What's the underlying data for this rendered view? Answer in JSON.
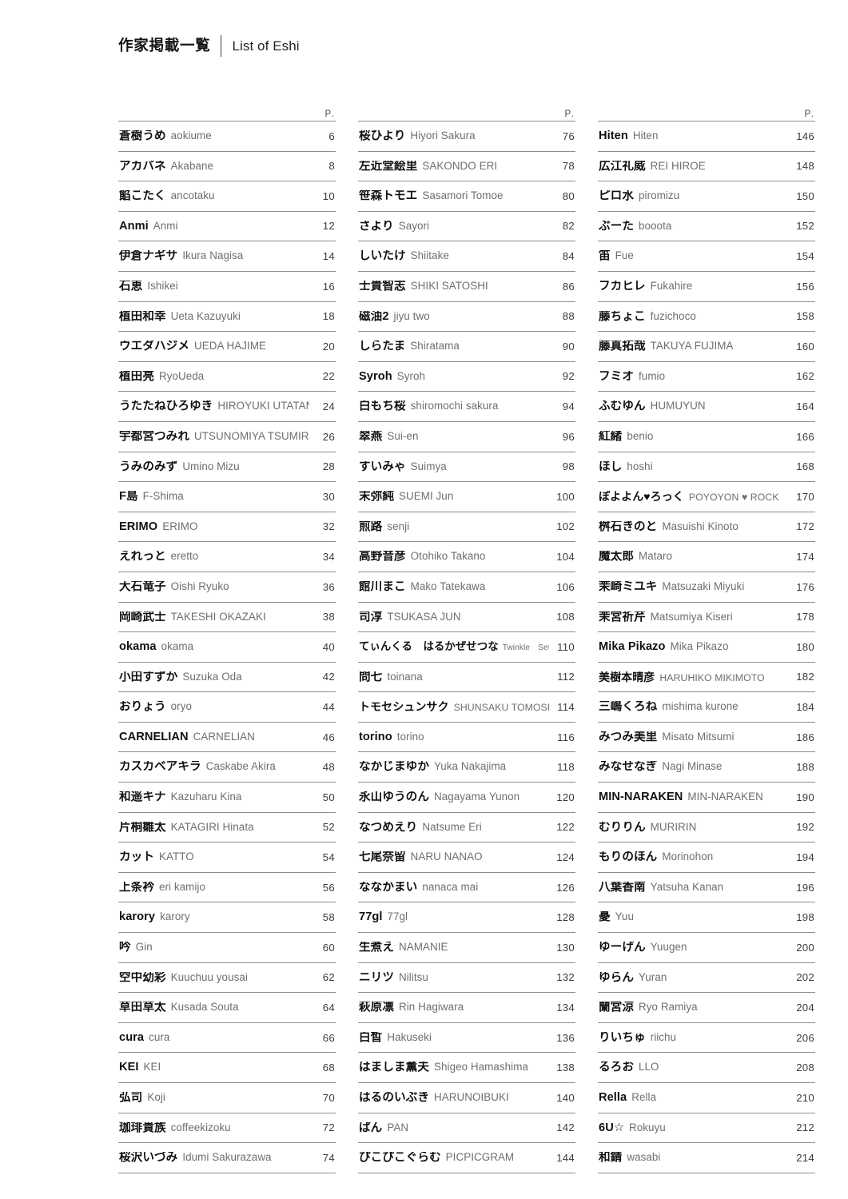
{
  "header": {
    "title_ja": "作家掲載一覧",
    "title_en": "List of Eshi"
  },
  "page_column_label": "P.",
  "colors": {
    "text": "#111111",
    "subtext": "#6e6e6e",
    "rule": "#8d8d8d",
    "page_number": "#3c3c3c",
    "background": "#ffffff"
  },
  "columns": [
    {
      "id": "column-1",
      "p_label": "P.",
      "entries": [
        {
          "name_ja": "蒼樹うめ",
          "name_en": "aokiume",
          "page": "6"
        },
        {
          "name_ja": "アカバネ",
          "name_en": "Akabane",
          "page": "8"
        },
        {
          "name_ja": "餡こたく",
          "name_en": "ancotaku",
          "page": "10"
        },
        {
          "name_ja": "Anmi",
          "name_en": "Anmi",
          "page": "12"
        },
        {
          "name_ja": "伊倉ナギサ",
          "name_en": "Ikura Nagisa",
          "page": "14"
        },
        {
          "name_ja": "石恵",
          "name_en": "Ishikei",
          "page": "16"
        },
        {
          "name_ja": "植田和幸",
          "name_en": "Ueta Kazuyuki",
          "page": "18"
        },
        {
          "name_ja": "ウエダハジメ",
          "name_en": "UEDA HAJIME",
          "page": "20"
        },
        {
          "name_ja": "植田亮",
          "name_en": "RyoUeda",
          "page": "22"
        },
        {
          "name_ja": "うたたねひろゆき",
          "name_en": "HIROYUKI UTATANE",
          "page": "24"
        },
        {
          "name_ja": "宇都宮つみれ",
          "name_en": "UTSUNOMIYA TSUMIRE",
          "page": "26"
        },
        {
          "name_ja": "うみのみず",
          "name_en": "Umino Mizu",
          "page": "28"
        },
        {
          "name_ja": "F島",
          "name_en": "F-Shima",
          "page": "30"
        },
        {
          "name_ja": "ERIMO",
          "name_en": "ERIMO",
          "page": "32"
        },
        {
          "name_ja": "えれっと",
          "name_en": "eretto",
          "page": "34"
        },
        {
          "name_ja": "大石竜子",
          "name_en": "Oishi Ryuko",
          "page": "36"
        },
        {
          "name_ja": "岡崎武士",
          "name_en": "TAKESHI OKAZAKI",
          "page": "38"
        },
        {
          "name_ja": "okama",
          "name_en": "okama",
          "page": "40"
        },
        {
          "name_ja": "小田すずか",
          "name_en": "Suzuka Oda",
          "page": "42"
        },
        {
          "name_ja": "おりょう",
          "name_en": "oryo",
          "page": "44"
        },
        {
          "name_ja": "CARNELIAN",
          "name_en": "CARNELIAN",
          "page": "46"
        },
        {
          "name_ja": "カスカベアキラ",
          "name_en": "Caskabe Akira",
          "page": "48"
        },
        {
          "name_ja": "和遥キナ",
          "name_en": "Kazuharu Kina",
          "page": "50"
        },
        {
          "name_ja": "片桐雛太",
          "name_en": "KATAGIRI Hinata",
          "page": "52"
        },
        {
          "name_ja": "カット",
          "name_en": "KATTO",
          "page": "54"
        },
        {
          "name_ja": "上条衿",
          "name_en": "eri kamijo",
          "page": "56"
        },
        {
          "name_ja": "karory",
          "name_en": "karory",
          "page": "58"
        },
        {
          "name_ja": "吟",
          "name_en": "Gin",
          "page": "60"
        },
        {
          "name_ja": "空中幼彩",
          "name_en": "Kuuchuu yousai",
          "page": "62"
        },
        {
          "name_ja": "草田草太",
          "name_en": "Kusada Souta",
          "page": "64"
        },
        {
          "name_ja": "cura",
          "name_en": "cura",
          "page": "66"
        },
        {
          "name_ja": "KEI",
          "name_en": "KEI",
          "page": "68"
        },
        {
          "name_ja": "弘司",
          "name_en": "Koji",
          "page": "70"
        },
        {
          "name_ja": "珈琲貴族",
          "name_en": "coffeekizoku",
          "page": "72"
        },
        {
          "name_ja": "桜沢いづみ",
          "name_en": "Idumi Sakurazawa",
          "page": "74"
        }
      ]
    },
    {
      "id": "column-2",
      "p_label": "P.",
      "entries": [
        {
          "name_ja": "桜ひより",
          "name_en": "Hiyori Sakura",
          "page": "76"
        },
        {
          "name_ja": "左近堂絵里",
          "name_en": "SAKONDO ERI",
          "page": "78"
        },
        {
          "name_ja": "笹森トモエ",
          "name_en": "Sasamori Tomoe",
          "page": "80"
        },
        {
          "name_ja": "さより",
          "name_en": "Sayori",
          "page": "82"
        },
        {
          "name_ja": "しいたけ",
          "name_en": "Shiitake",
          "page": "84"
        },
        {
          "name_ja": "士貴智志",
          "name_en": "SHIKI SATOSHI",
          "page": "86"
        },
        {
          "name_ja": "磁油2",
          "name_en": "jiyu two",
          "page": "88"
        },
        {
          "name_ja": "しらたま",
          "name_en": "Shiratama",
          "page": "90"
        },
        {
          "name_ja": "Syroh",
          "name_en": "Syroh",
          "page": "92"
        },
        {
          "name_ja": "白もち桜",
          "name_en": "shiromochi sakura",
          "page": "94"
        },
        {
          "name_ja": "翠燕",
          "name_en": "Sui-en",
          "page": "96"
        },
        {
          "name_ja": "すいみゃ",
          "name_en": "Suimya",
          "page": "98"
        },
        {
          "name_ja": "末弥純",
          "name_en": "SUEMI Jun",
          "page": "100"
        },
        {
          "name_ja": "煎路",
          "name_en": "senji",
          "page": "102"
        },
        {
          "name_ja": "高野音彦",
          "name_en": "Otohiko Takano",
          "page": "104"
        },
        {
          "name_ja": "館川まこ",
          "name_en": "Mako Tatekawa",
          "page": "106"
        },
        {
          "name_ja": "司淳",
          "name_en": "TSUKASA JUN",
          "page": "108"
        },
        {
          "name_ja": "てぃんくる　はるかぜせつな",
          "name_en": "Twinkle　Setsuna Harukaze",
          "page": "110",
          "size": "tighter"
        },
        {
          "name_ja": "問七",
          "name_en": "toinana",
          "page": "112"
        },
        {
          "name_ja": "トモセシュンサク",
          "name_en": "SHUNSAKU TOMOSE",
          "page": "114",
          "size": "tight"
        },
        {
          "name_ja": "torino",
          "name_en": "torino",
          "page": "116"
        },
        {
          "name_ja": "なかじまゆか",
          "name_en": "Yuka Nakajima",
          "page": "118"
        },
        {
          "name_ja": "永山ゆうのん",
          "name_en": "Nagayama Yunon",
          "page": "120"
        },
        {
          "name_ja": "なつめえり",
          "name_en": "Natsume Eri",
          "page": "122"
        },
        {
          "name_ja": "七尾奈留",
          "name_en": "NARU NANAO",
          "page": "124"
        },
        {
          "name_ja": "ななかまい",
          "name_en": "nanaca mai",
          "page": "126"
        },
        {
          "name_ja": "77gl",
          "name_en": "77gl",
          "page": "128"
        },
        {
          "name_ja": "生煮え",
          "name_en": "NAMANIE",
          "page": "130"
        },
        {
          "name_ja": "ニリツ",
          "name_en": "Nilitsu",
          "page": "132"
        },
        {
          "name_ja": "萩原凛",
          "name_en": "Rin Hagiwara",
          "page": "134"
        },
        {
          "name_ja": "白皙",
          "name_en": "Hakuseki",
          "page": "136"
        },
        {
          "name_ja": "はましま薫夫",
          "name_en": "Shigeo Hamashima",
          "page": "138"
        },
        {
          "name_ja": "はるのいぶき",
          "name_en": "HARUNOIBUKI",
          "page": "140"
        },
        {
          "name_ja": "ぱん",
          "name_en": "PAN",
          "page": "142"
        },
        {
          "name_ja": "ぴこぴこぐらむ",
          "name_en": "PICPICGRAM",
          "page": "144"
        }
      ]
    },
    {
      "id": "column-3",
      "p_label": "P.",
      "entries": [
        {
          "name_ja": "Hiten",
          "name_en": "Hiten",
          "page": "146"
        },
        {
          "name_ja": "広江礼威",
          "name_en": "REI HIROE",
          "page": "148"
        },
        {
          "name_ja": "ピロ水",
          "name_en": "piromizu",
          "page": "150"
        },
        {
          "name_ja": "ぶーた",
          "name_en": "booota",
          "page": "152"
        },
        {
          "name_ja": "笛",
          "name_en": "Fue",
          "page": "154"
        },
        {
          "name_ja": "フカヒレ",
          "name_en": "Fukahire",
          "page": "156"
        },
        {
          "name_ja": "藤ちょこ",
          "name_en": "fuzichoco",
          "page": "158"
        },
        {
          "name_ja": "藤真拓哉",
          "name_en": "TAKUYA FUJIMA",
          "page": "160"
        },
        {
          "name_ja": "フミオ",
          "name_en": "fumio",
          "page": "162"
        },
        {
          "name_ja": "ふむゆん",
          "name_en": "HUMUYUN",
          "page": "164"
        },
        {
          "name_ja": "紅緒",
          "name_en": "benio",
          "page": "166"
        },
        {
          "name_ja": "ほし",
          "name_en": "hoshi",
          "page": "168"
        },
        {
          "name_ja": "ぽよよん♥ろっく",
          "name_en": "POYOYON ♥ ROCK",
          "page": "170",
          "size": "tight"
        },
        {
          "name_ja": "桝石きのと",
          "name_en": "Masuishi Kinoto",
          "page": "172"
        },
        {
          "name_ja": "魔太郎",
          "name_en": "Mataro",
          "page": "174"
        },
        {
          "name_ja": "茉崎ミユキ",
          "name_en": "Matsuzaki Miyuki",
          "page": "176"
        },
        {
          "name_ja": "茉宮祈芹",
          "name_en": "Matsumiya Kiseri",
          "page": "178"
        },
        {
          "name_ja": "Mika Pikazo",
          "name_en": "Mika Pikazo",
          "page": "180"
        },
        {
          "name_ja": "美樹本晴彦",
          "name_en": "HARUHIKO MIKIMOTO",
          "page": "182",
          "size": "tight"
        },
        {
          "name_ja": "三嶋くろね",
          "name_en": "mishima kurone",
          "page": "184"
        },
        {
          "name_ja": "みつみ美里",
          "name_en": "Misato Mitsumi",
          "page": "186"
        },
        {
          "name_ja": "みなせなぎ",
          "name_en": "Nagi Minase",
          "page": "188"
        },
        {
          "name_ja": "MIN-NARAKEN",
          "name_en": "MIN-NARAKEN",
          "page": "190"
        },
        {
          "name_ja": "むりりん",
          "name_en": "MURIRIN",
          "page": "192"
        },
        {
          "name_ja": "もりのほん",
          "name_en": "Morinohon",
          "page": "194"
        },
        {
          "name_ja": "八葉香南",
          "name_en": "Yatsuha Kanan",
          "page": "196"
        },
        {
          "name_ja": "憂",
          "name_en": "Yuu",
          "page": "198"
        },
        {
          "name_ja": "ゆーげん",
          "name_en": "Yuugen",
          "page": "200"
        },
        {
          "name_ja": "ゆらん",
          "name_en": "Yuran",
          "page": "202"
        },
        {
          "name_ja": "蘭宮涼",
          "name_en": "Ryo Ramiya",
          "page": "204"
        },
        {
          "name_ja": "りいちゅ",
          "name_en": "riichu",
          "page": "206"
        },
        {
          "name_ja": "るろお",
          "name_en": "LLO",
          "page": "208"
        },
        {
          "name_ja": "Rella",
          "name_en": "Rella",
          "page": "210"
        },
        {
          "name_ja": "6U☆",
          "name_en": "Rokuyu",
          "page": "212"
        },
        {
          "name_ja": "和錆",
          "name_en": "wasabi",
          "page": "214"
        }
      ]
    }
  ]
}
